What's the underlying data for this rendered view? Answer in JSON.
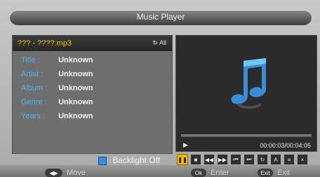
{
  "app": {
    "title": "Music Player"
  },
  "file": {
    "name": "??? - ????.mp3",
    "repeat_label": "All"
  },
  "metadata": [
    {
      "label": "Title :",
      "value": "Unknown"
    },
    {
      "label": "Artist :",
      "value": "Unknown"
    },
    {
      "label": "Album :",
      "value": "Unknown"
    },
    {
      "label": "Genre :",
      "value": "Unknown"
    },
    {
      "label": "Years :",
      "value": "Unknown"
    }
  ],
  "playback": {
    "time_current": "00:00:03",
    "time_total": "/00:04:05",
    "progress": 0.01
  },
  "backlight": {
    "label": "Backlight",
    "state": "Off"
  },
  "footer": {
    "move_label": "Move",
    "ok_key": "Ok",
    "enter_label": "Enter",
    "exit_key": "Exit",
    "exit_label": "Exit"
  },
  "colors": {
    "accent": "#f2b600",
    "meta_label": "#46b8f0",
    "file_name": "#ffc000"
  }
}
